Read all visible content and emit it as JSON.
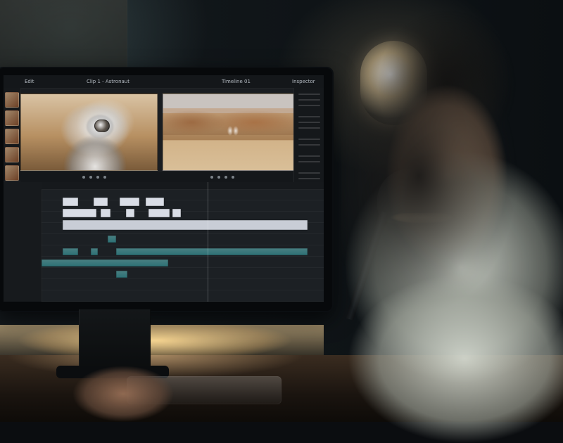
{
  "ui": {
    "topbar": {
      "left_label": "Edit",
      "center_label": "Clip 1 - Astronaut",
      "right_label": "Timeline 01",
      "right_actions_label": "Inspector"
    }
  }
}
